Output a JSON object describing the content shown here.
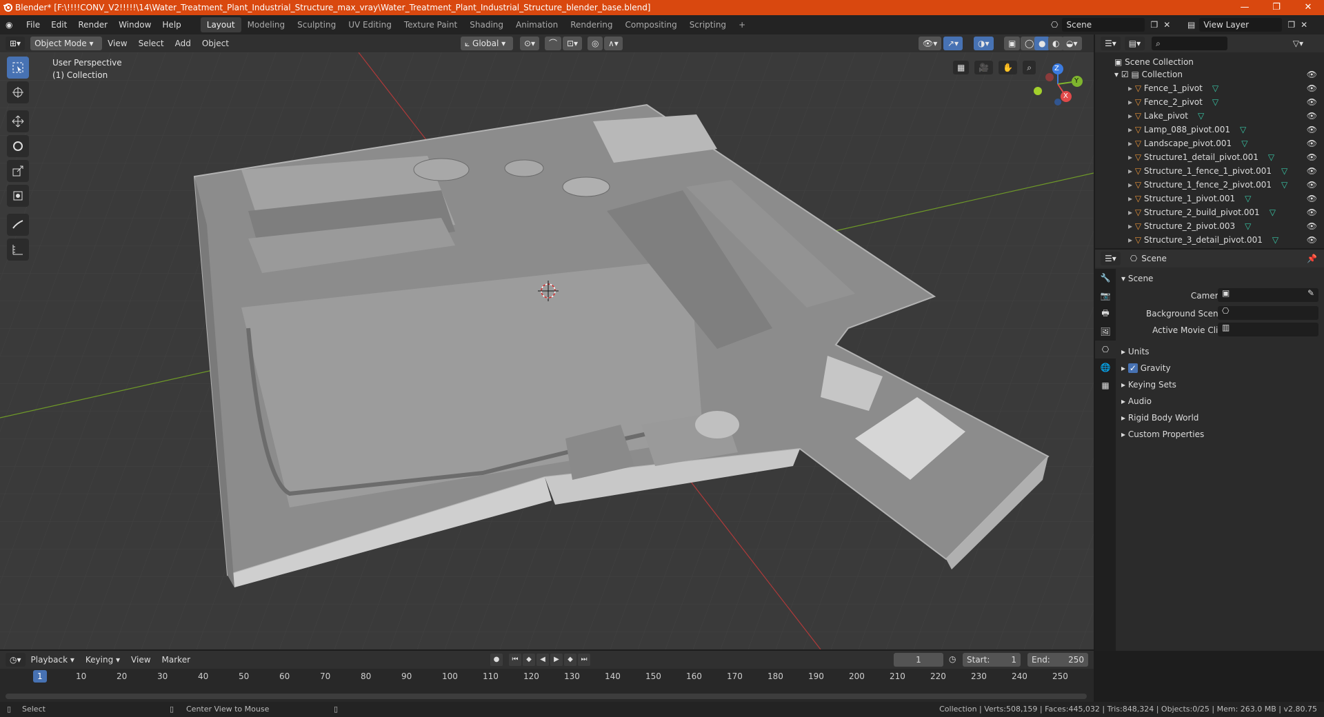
{
  "window": {
    "title": "Blender* [F:\\!!!!CONV_V2!!!!!\\14\\Water_Treatment_Plant_Industrial_Structure_max_vray\\Water_Treatment_Plant_Industrial_Structure_blender_base.blend]",
    "accent": "#d9480f"
  },
  "menu": [
    "File",
    "Edit",
    "Render",
    "Window",
    "Help"
  ],
  "workspaces": [
    "Layout",
    "Modeling",
    "Sculpting",
    "UV Editing",
    "Texture Paint",
    "Shading",
    "Animation",
    "Rendering",
    "Compositing",
    "Scripting"
  ],
  "active_workspace": "Layout",
  "scene_field": "Scene",
  "view_layer_field": "View Layer",
  "viewport_header": {
    "mode": "Object Mode",
    "menus": [
      "View",
      "Select",
      "Add",
      "Object"
    ],
    "transform": "Global"
  },
  "viewport": {
    "perspective": "User Perspective",
    "collection": "(1) Collection",
    "gizmo": {
      "x": "X",
      "y": "Y",
      "z": "Z"
    }
  },
  "outliner": {
    "root": "Scene Collection",
    "collection": "Collection",
    "items": [
      "Fence_1_pivot",
      "Fence_2_pivot",
      "Lake_pivot",
      "Lamp_088_pivot.001",
      "Landscape_pivot.001",
      "Structure1_detail_pivot.001",
      "Structure_1_fence_1_pivot.001",
      "Structure_1_fence_2_pivot.001",
      "Structure_1_pivot.001",
      "Structure_2_build_pivot.001",
      "Structure_2_pivot.003",
      "Structure_3_detail_pivot.001"
    ]
  },
  "properties": {
    "header": "Scene",
    "section": "Scene",
    "camera_label": "Camera",
    "background_label": "Background Scene",
    "movieclip_label": "Active Movie Clip",
    "panels": [
      "Units",
      "Gravity",
      "Keying Sets",
      "Audio",
      "Rigid Body World",
      "Custom Properties"
    ],
    "gravity_checked": true
  },
  "timeline": {
    "menus": [
      "Playback",
      "Keying",
      "View",
      "Marker"
    ],
    "current_frame": "1",
    "start_label": "Start:",
    "start": "1",
    "end_label": "End:",
    "end": "250",
    "ticks": [
      "1",
      "10",
      "20",
      "30",
      "40",
      "50",
      "60",
      "70",
      "80",
      "90",
      "100",
      "110",
      "120",
      "130",
      "140",
      "150",
      "160",
      "170",
      "180",
      "190",
      "200",
      "210",
      "220",
      "230",
      "240",
      "250"
    ]
  },
  "status": {
    "left": "Select",
    "middle": "Center View to Mouse",
    "right": "Collection | Verts:508,159 | Faces:445,032 | Tris:848,324 | Objects:0/25 | Mem: 263.0 MB | v2.80.75"
  }
}
